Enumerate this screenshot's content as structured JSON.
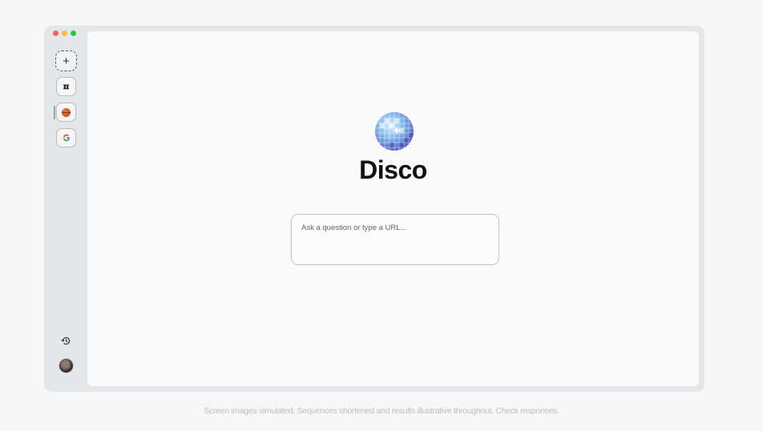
{
  "app": {
    "name": "Disco"
  },
  "sidebar": {
    "new_tab_icon": "plus-icon",
    "tabs": [
      {
        "icon": "nyt-icon",
        "glyph": "ℼ"
      },
      {
        "icon": "basketball-icon",
        "active": true
      },
      {
        "icon": "google-icon",
        "glyph": "G"
      }
    ],
    "history_icon": "history-icon",
    "avatar_icon": "user-avatar"
  },
  "main": {
    "logo_icon": "disco-ball-icon",
    "title": "Disco",
    "search": {
      "placeholder": "Ask a question or type a URL...",
      "value": ""
    }
  },
  "footer": {
    "disclaimer": "Screen images simulated. Sequences shortened and results illustrative throughout. Check responses."
  },
  "colors": {
    "window_frame": "#e4e7ea",
    "content_bg": "#fafafa",
    "close": "#ff5f57",
    "minimize": "#febc2e",
    "maximize": "#28c840"
  }
}
